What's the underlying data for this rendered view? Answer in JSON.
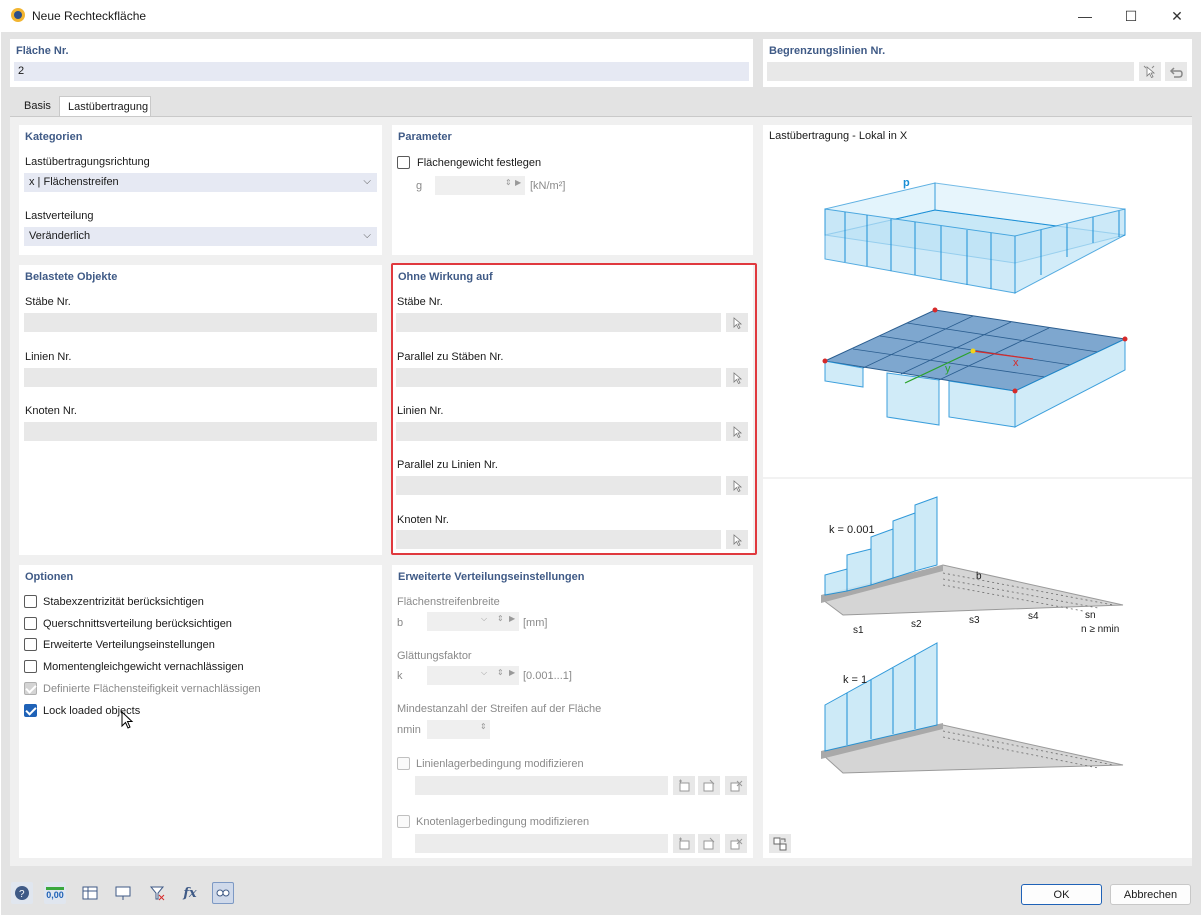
{
  "window": {
    "title": "Neue Rechteckfläche",
    "minimize": "—",
    "maximize": "☐",
    "close": "✕"
  },
  "header": {
    "surface_label": "Fläche Nr.",
    "surface_value": "2",
    "boundary_label": "Begrenzungslinien Nr.",
    "boundary_value": ""
  },
  "tabs": [
    {
      "label": "Basis"
    },
    {
      "label": "Lastübertragung",
      "active": true
    }
  ],
  "kategorien": {
    "title": "Kategorien",
    "direction_label": "Lastübertragungsrichtung",
    "direction_value": "x | Flächenstreifen",
    "distribution_label": "Lastverteilung",
    "distribution_value": "Veränderlich"
  },
  "parameter": {
    "title": "Parameter",
    "weight_checkbox": "Flächengewicht festlegen",
    "weight_checked": false,
    "g_label": "g",
    "g_unit": "[kN/m²]"
  },
  "belastete": {
    "title": "Belastete Objekte",
    "members_label": "Stäbe Nr.",
    "lines_label": "Linien Nr.",
    "nodes_label": "Knoten Nr."
  },
  "ohne_wirkung": {
    "title": "Ohne Wirkung auf",
    "fields": [
      {
        "label": "Stäbe Nr."
      },
      {
        "label": "Parallel zu Stäben Nr."
      },
      {
        "label": "Linien Nr."
      },
      {
        "label": "Parallel zu Linien Nr."
      },
      {
        "label": "Knoten Nr."
      }
    ]
  },
  "optionen": {
    "title": "Optionen",
    "items": [
      {
        "label": "Stabexzentrizität berücksichtigen",
        "state": "unchecked"
      },
      {
        "label": "Querschnittsverteilung berücksichtigen",
        "state": "unchecked"
      },
      {
        "label": "Erweiterte Verteilungseinstellungen",
        "state": "unchecked"
      },
      {
        "label": "Momentengleichgewicht vernachlässigen",
        "state": "unchecked"
      },
      {
        "label": "Definierte Flächensteifigkeit vernachlässigen",
        "state": "disabled-checked"
      },
      {
        "label": "Lock loaded objects",
        "state": "checked"
      }
    ]
  },
  "erweiterte": {
    "title": "Erweiterte Verteilungseinstellungen",
    "strip_width_label": "Flächenstreifenbreite",
    "b_label": "b",
    "b_unit": "[mm]",
    "smoothing_label": "Glättungsfaktor",
    "k_label": "k",
    "k_range": "[0.001...1]",
    "min_strips_label": "Mindestanzahl der Streifen auf der Fläche",
    "nmin_label": "nmin",
    "line_support_label": "Linienlagerbedingung modifizieren",
    "node_support_label": "Knotenlagerbedingung modifizieren"
  },
  "preview": {
    "title": "Lastübertragung - Lokal in X",
    "p_label": "p",
    "x_label": "x",
    "y_label": "y",
    "k1_label": "k = 0.001",
    "k2_label": "k = 1",
    "b_label": "b",
    "s1": "s1",
    "s2": "s2",
    "s3": "s3",
    "s4": "s4",
    "sn": "sn",
    "n_cond": "n ≥ nmin"
  },
  "footer": {
    "ok": "OK",
    "cancel": "Abbrechen",
    "unit_icon_text": "0,00"
  },
  "colors": {
    "accent": "#1f62b7",
    "section_title": "#3f5a86",
    "highlight": "#e0393e",
    "load_blue": "#1b8fd6"
  }
}
